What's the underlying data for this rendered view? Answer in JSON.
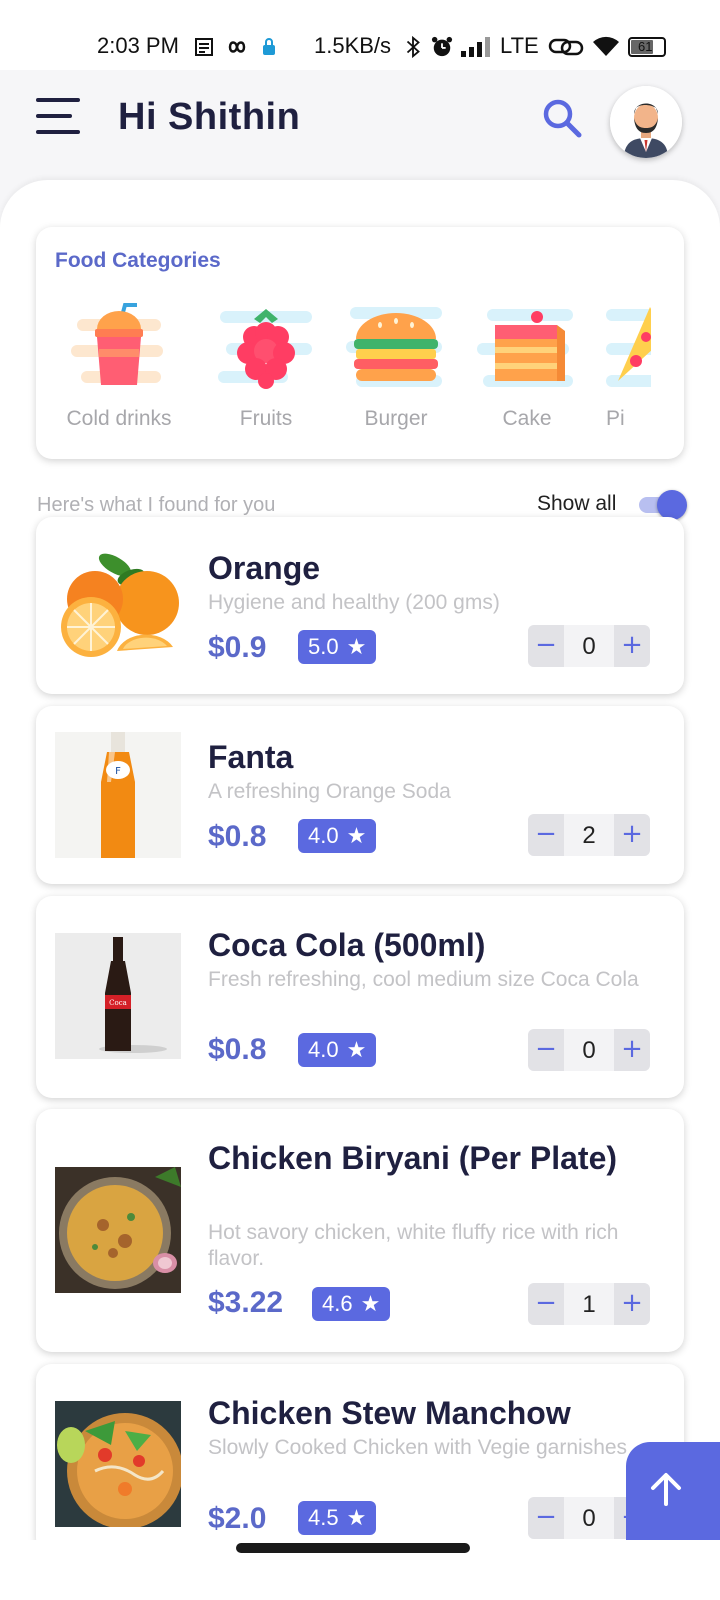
{
  "status_bar": {
    "time": "2:03 PM",
    "speed": "1.5KB/s",
    "network": "LTE",
    "battery": "61",
    "icons": [
      "notes-icon",
      "infinity-icon",
      "lock-icon",
      "bluetooth-icon",
      "alarm-icon",
      "signal-icon",
      "link-icon",
      "wifi-icon",
      "battery-icon"
    ]
  },
  "header": {
    "greeting": "Hi Shithin",
    "menu_icon": "hamburger-menu-icon",
    "search_icon": "search-icon",
    "avatar": "user-avatar"
  },
  "categories": {
    "title": "Food Categories",
    "items": [
      {
        "label": "Cold drinks",
        "icon": "cold-drink-icon"
      },
      {
        "label": "Fruits",
        "icon": "raspberry-icon"
      },
      {
        "label": "Burger",
        "icon": "burger-icon"
      },
      {
        "label": "Cake",
        "icon": "cake-icon"
      },
      {
        "label": "Pi",
        "icon": "pizza-icon"
      }
    ]
  },
  "results": {
    "heading": "Here's what I found for you",
    "show_all_label": "Show all",
    "show_all_enabled": true
  },
  "products": [
    {
      "name": "Orange",
      "description": "Hygiene and healthy (200 gms)",
      "price": "$0.9",
      "rating": "5.0",
      "quantity": "0"
    },
    {
      "name": "Fanta",
      "description": "A refreshing Orange Soda",
      "price": "$0.8",
      "rating": "4.0",
      "quantity": "2"
    },
    {
      "name": "Coca Cola (500ml)",
      "description": "Fresh refreshing, cool medium size Coca Cola",
      "price": "$0.8",
      "rating": "4.0",
      "quantity": "0"
    },
    {
      "name": "Chicken Biryani (Per Plate)",
      "description": "Hot savory chicken, white fluffy rice with rich flavor.",
      "price": "$3.22",
      "rating": "4.6",
      "quantity": "1"
    },
    {
      "name": "Chicken Stew Manchow",
      "description": "Slowly Cooked Chicken with Vegie garnishes",
      "price": "$2.0",
      "rating": "4.5",
      "quantity": "0"
    }
  ],
  "stepper": {
    "minus": "−",
    "plus": "+"
  },
  "star_glyph": "★",
  "colors": {
    "accent": "#5b69e0",
    "price": "#5b69c9",
    "title": "#1f2040",
    "muted": "#c3c3c6"
  }
}
